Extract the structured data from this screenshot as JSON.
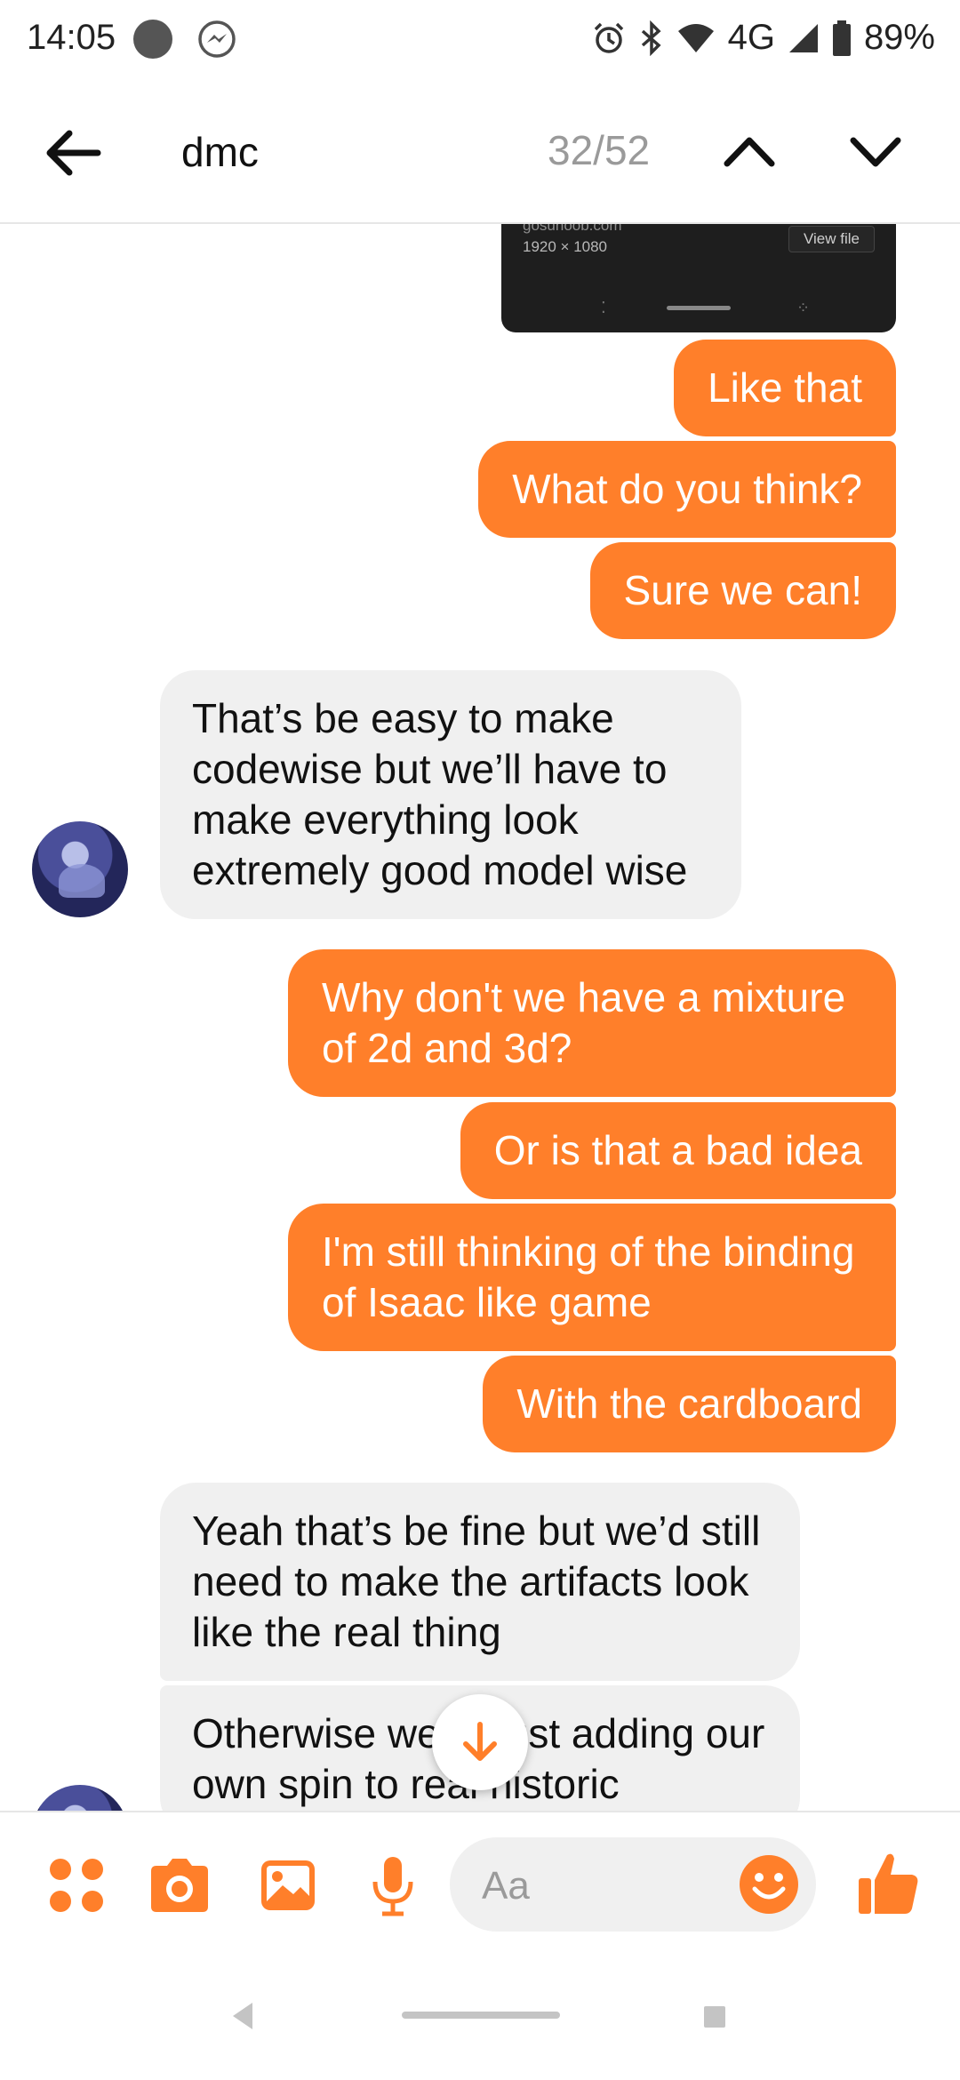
{
  "status_bar": {
    "time": "14:05",
    "network": "4G",
    "battery": "89%"
  },
  "header": {
    "search_query": "dmc",
    "result_counter": "32/52"
  },
  "image_attachment": {
    "source_text": "gosuhoob.com",
    "dimensions": "1920 × 1080",
    "view_file_label": "View file"
  },
  "messages": [
    {
      "direction": "outgoing",
      "text": "Like that"
    },
    {
      "direction": "outgoing",
      "text": "What do you think?"
    },
    {
      "direction": "outgoing",
      "text": "Sure we can!"
    },
    {
      "direction": "incoming",
      "text": "That’s be easy to make codewise but we’ll have to make everything look extremely good model wise"
    },
    {
      "direction": "outgoing",
      "text": "Why don't we have a mixture of 2d and 3d?"
    },
    {
      "direction": "outgoing",
      "text": "Or is that a bad idea"
    },
    {
      "direction": "outgoing",
      "text": "I'm still thinking of the binding of Isaac like game"
    },
    {
      "direction": "outgoing",
      "text": "With the cardboard"
    },
    {
      "direction": "incoming",
      "text": "Yeah that’s be fine but we’d still need to make the artifacts look like the real thing"
    },
    {
      "direction": "incoming",
      "text": "Otherwise we’re just adding our own spin to real historic"
    }
  ],
  "composer": {
    "placeholder": "Aa"
  },
  "colors": {
    "accent": "#ff7f2a",
    "incoming_bubble": "#f0f0f0"
  }
}
